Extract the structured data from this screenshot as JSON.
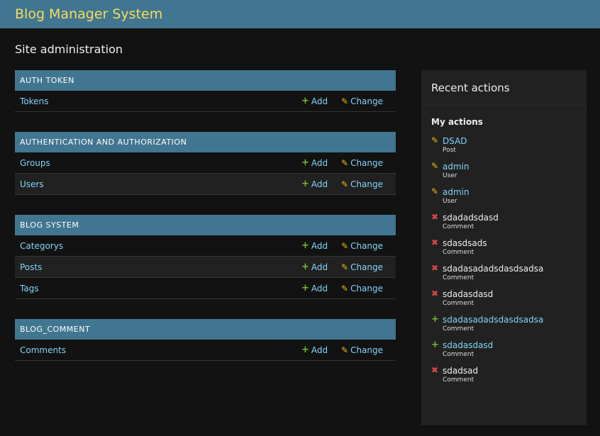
{
  "header": {
    "title": "Blog Manager System"
  },
  "page_title": "Site administration",
  "add_label": "Add",
  "change_label": "Change",
  "modules": [
    {
      "caption": "AUTH TOKEN",
      "models": [
        "Tokens"
      ]
    },
    {
      "caption": "AUTHENTICATION AND AUTHORIZATION",
      "models": [
        "Groups",
        "Users"
      ]
    },
    {
      "caption": "BLOG SYSTEM",
      "models": [
        "Categorys",
        "Posts",
        "Tags"
      ]
    },
    {
      "caption": "BLOG_COMMENT",
      "models": [
        "Comments"
      ]
    }
  ],
  "sidebar": {
    "title": "Recent actions",
    "subtitle": "My actions",
    "actions": [
      {
        "type": "change",
        "name": "DSAD",
        "ctype": "Post"
      },
      {
        "type": "change",
        "name": "admin",
        "ctype": "User"
      },
      {
        "type": "change",
        "name": "admin",
        "ctype": "User"
      },
      {
        "type": "delete",
        "name": "sdadadsdasd",
        "ctype": "Comment"
      },
      {
        "type": "delete",
        "name": "sdasdsads",
        "ctype": "Comment"
      },
      {
        "type": "delete",
        "name": "sdadasadadsdasdsadsa",
        "ctype": "Comment"
      },
      {
        "type": "delete",
        "name": "sdadasdasd",
        "ctype": "Comment"
      },
      {
        "type": "add",
        "name": "sdadasadadsdasdsadsa",
        "ctype": "Comment"
      },
      {
        "type": "add",
        "name": "sdadasdasd",
        "ctype": "Comment"
      },
      {
        "type": "delete",
        "name": "sdadsad",
        "ctype": "Comment"
      }
    ]
  }
}
